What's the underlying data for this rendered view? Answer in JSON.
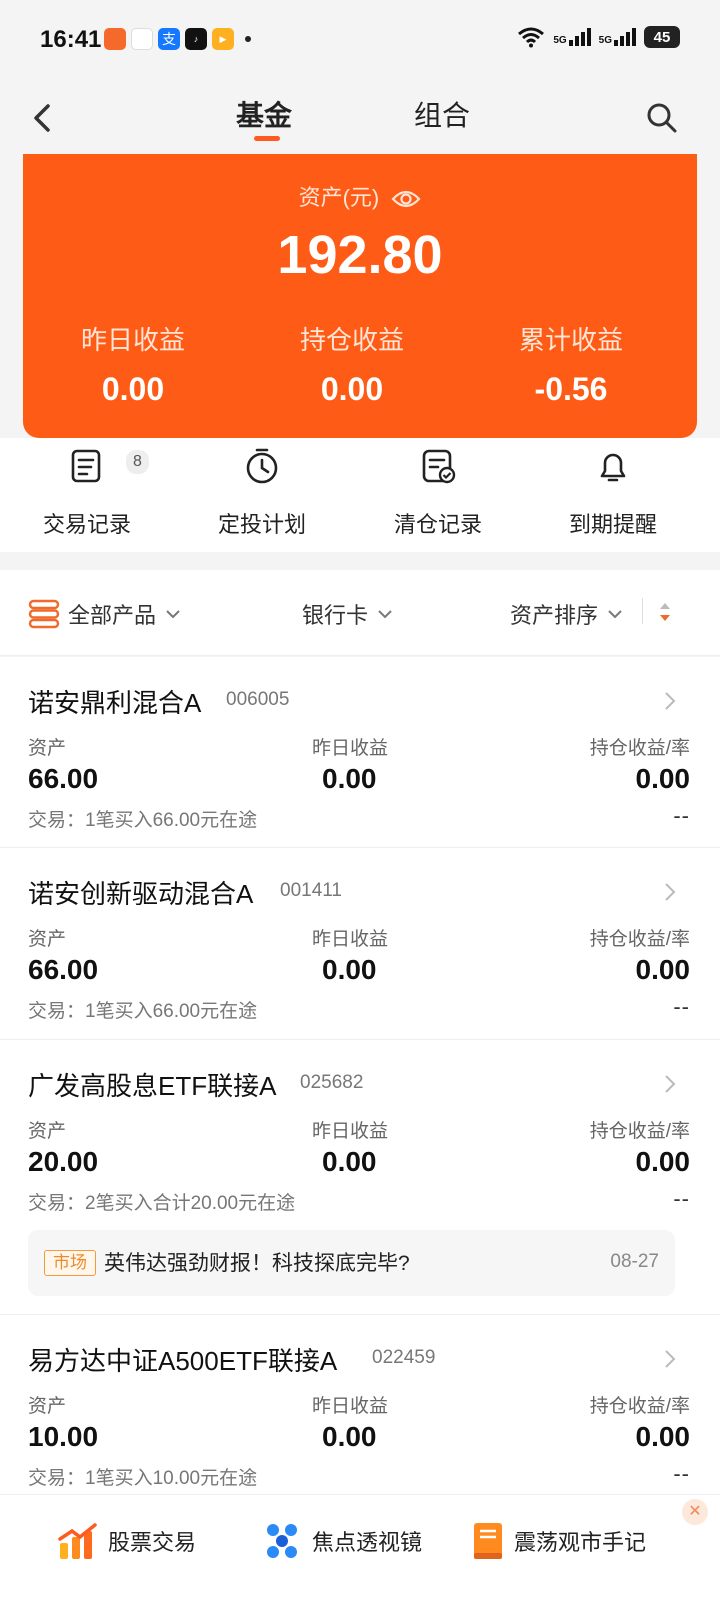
{
  "status_bar": {
    "time": "16:41",
    "signal_1": "5G",
    "signal_2": "5G",
    "battery": "45"
  },
  "nav": {
    "tabs": [
      "基金",
      "组合"
    ],
    "active_tab": "基金",
    "accent_color": "#fe5c16"
  },
  "summary": {
    "asset_label": "资产(元)",
    "asset_value": "192.80",
    "stats": [
      {
        "label": "昨日收益",
        "value": "0.00"
      },
      {
        "label": "持仓收益",
        "value": "0.00"
      },
      {
        "label": "累计收益",
        "value": "-0.56"
      }
    ]
  },
  "quick_actions": [
    {
      "label": "交易记录",
      "icon": "transaction-record-icon",
      "badge": "8"
    },
    {
      "label": "定投计划",
      "icon": "stopwatch-icon"
    },
    {
      "label": "清仓记录",
      "icon": "clear-record-icon"
    },
    {
      "label": "到期提醒",
      "icon": "bell-icon"
    }
  ],
  "filters": {
    "product": "全部产品",
    "bank_card": "银行卡",
    "sort": "资产排序"
  },
  "column_labels": {
    "asset": "资产",
    "yesterday": "昨日收益",
    "holding": "持仓收益/率"
  },
  "funds": [
    {
      "name": "诺安鼎利混合A",
      "code": "006005",
      "asset": "66.00",
      "yesterday": "0.00",
      "holding": "0.00",
      "holding_rate": "--",
      "trade": "交易：1笔买入66.00元在途"
    },
    {
      "name": "诺安创新驱动混合A",
      "code": "001411",
      "asset": "66.00",
      "yesterday": "0.00",
      "holding": "0.00",
      "holding_rate": "--",
      "trade": "交易：1笔买入66.00元在途"
    },
    {
      "name": "广发高股息ETF联接A",
      "code": "025682",
      "asset": "20.00",
      "yesterday": "0.00",
      "holding": "0.00",
      "holding_rate": "--",
      "trade": "交易：2笔买入合计20.00元在途",
      "news": {
        "tag": "市场",
        "title": "英伟达强劲财报！科技探底完毕?",
        "date": "08-27"
      }
    },
    {
      "name": "易方达中证A500ETF联接A",
      "code": "022459",
      "asset": "10.00",
      "yesterday": "0.00",
      "holding": "0.00",
      "holding_rate": "--",
      "trade": "交易：1笔买入10.00元在途"
    }
  ],
  "bottom_banner": [
    {
      "label": "股票交易",
      "icon": "stock-trade-icon"
    },
    {
      "label": "焦点透视镜",
      "icon": "focus-lens-icon"
    },
    {
      "label": "震荡观市手记",
      "icon": "notebook-icon"
    }
  ]
}
